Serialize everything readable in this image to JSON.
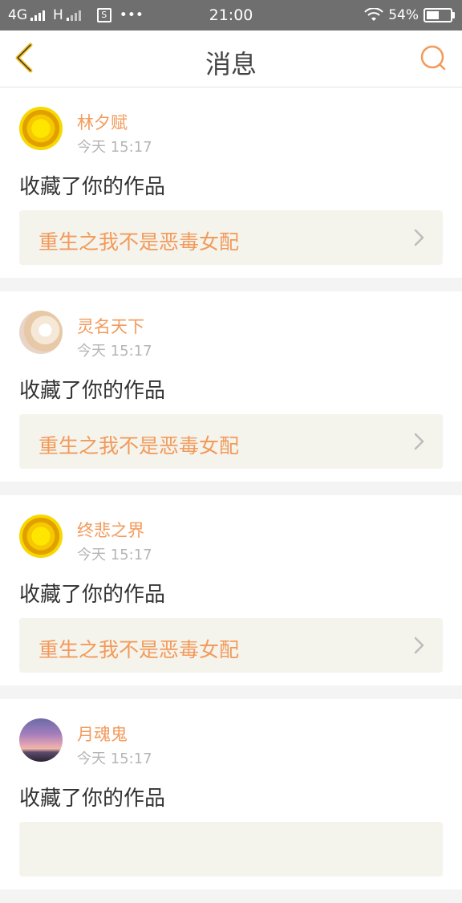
{
  "status_bar": {
    "network_1": "4G",
    "network_2": "H",
    "sim_label": "S",
    "more": "•••",
    "time": "21:00",
    "battery_percent": "54%",
    "battery_level": 0.54
  },
  "header": {
    "title": "消息"
  },
  "colors": {
    "accent": "#f39a5b",
    "header_text": "#444444"
  },
  "messages": [
    {
      "user": "林夕赋",
      "time": "今天 15:17",
      "action": "收藏了你的作品",
      "work_title": "重生之我不是恶毒女配",
      "avatar": "sunflower-avatar"
    },
    {
      "user": "灵名天下",
      "time": "今天 15:17",
      "action": "收藏了你的作品",
      "work_title": "重生之我不是恶毒女配",
      "avatar": "teacup-avatar"
    },
    {
      "user": "终悲之界",
      "time": "今天 15:17",
      "action": "收藏了你的作品",
      "work_title": "重生之我不是恶毒女配",
      "avatar": "sunflower-avatar"
    },
    {
      "user": "月魂鬼",
      "time": "今天 15:17",
      "action": "收藏了你的作品",
      "work_title": "",
      "avatar": "sunset-avatar"
    }
  ]
}
